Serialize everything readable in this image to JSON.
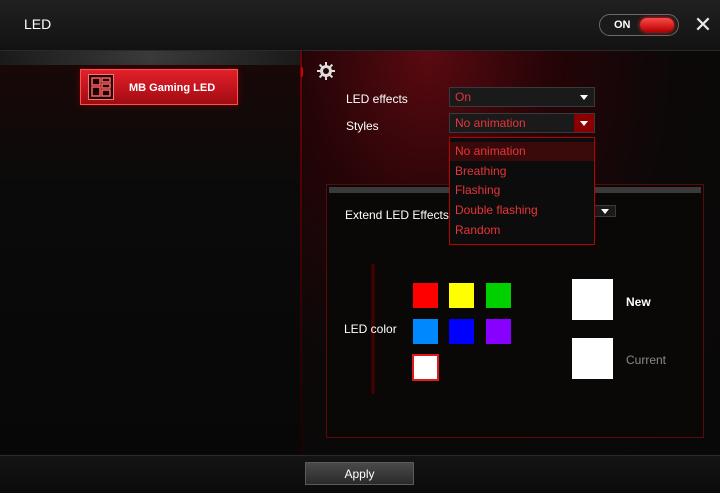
{
  "window": {
    "title": "LED"
  },
  "power_toggle": {
    "label": "ON",
    "state": "on"
  },
  "close_icon": "close-icon",
  "sidebar": {
    "device_label": "MB Gaming LED",
    "device_icon": "motherboard-icon"
  },
  "settings_icon": "gear-icon",
  "led_effects": {
    "label": "LED effects",
    "value": "On"
  },
  "styles": {
    "label": "Styles",
    "value": "No animation",
    "options": [
      "No animation",
      "Breathing",
      "Flashing",
      "Double flashing",
      "Random"
    ]
  },
  "extend": {
    "label": "Extend LED Effects"
  },
  "led_color": {
    "label": "LED color",
    "swatches": [
      "#ff0000",
      "#ffff00",
      "#00d000",
      "#0088ff",
      "#0000ff",
      "#8800ff",
      "#ffffff"
    ],
    "selected_swatch": "#ffffff",
    "new_label": "New",
    "current_label": "Current",
    "new_color": "#ffffff",
    "current_color": "#ffffff"
  },
  "footer": {
    "apply_label": "Apply"
  },
  "colors": {
    "accent": "#e01a1a",
    "option_text": "#e8343a",
    "background": "#0b0b0b"
  }
}
